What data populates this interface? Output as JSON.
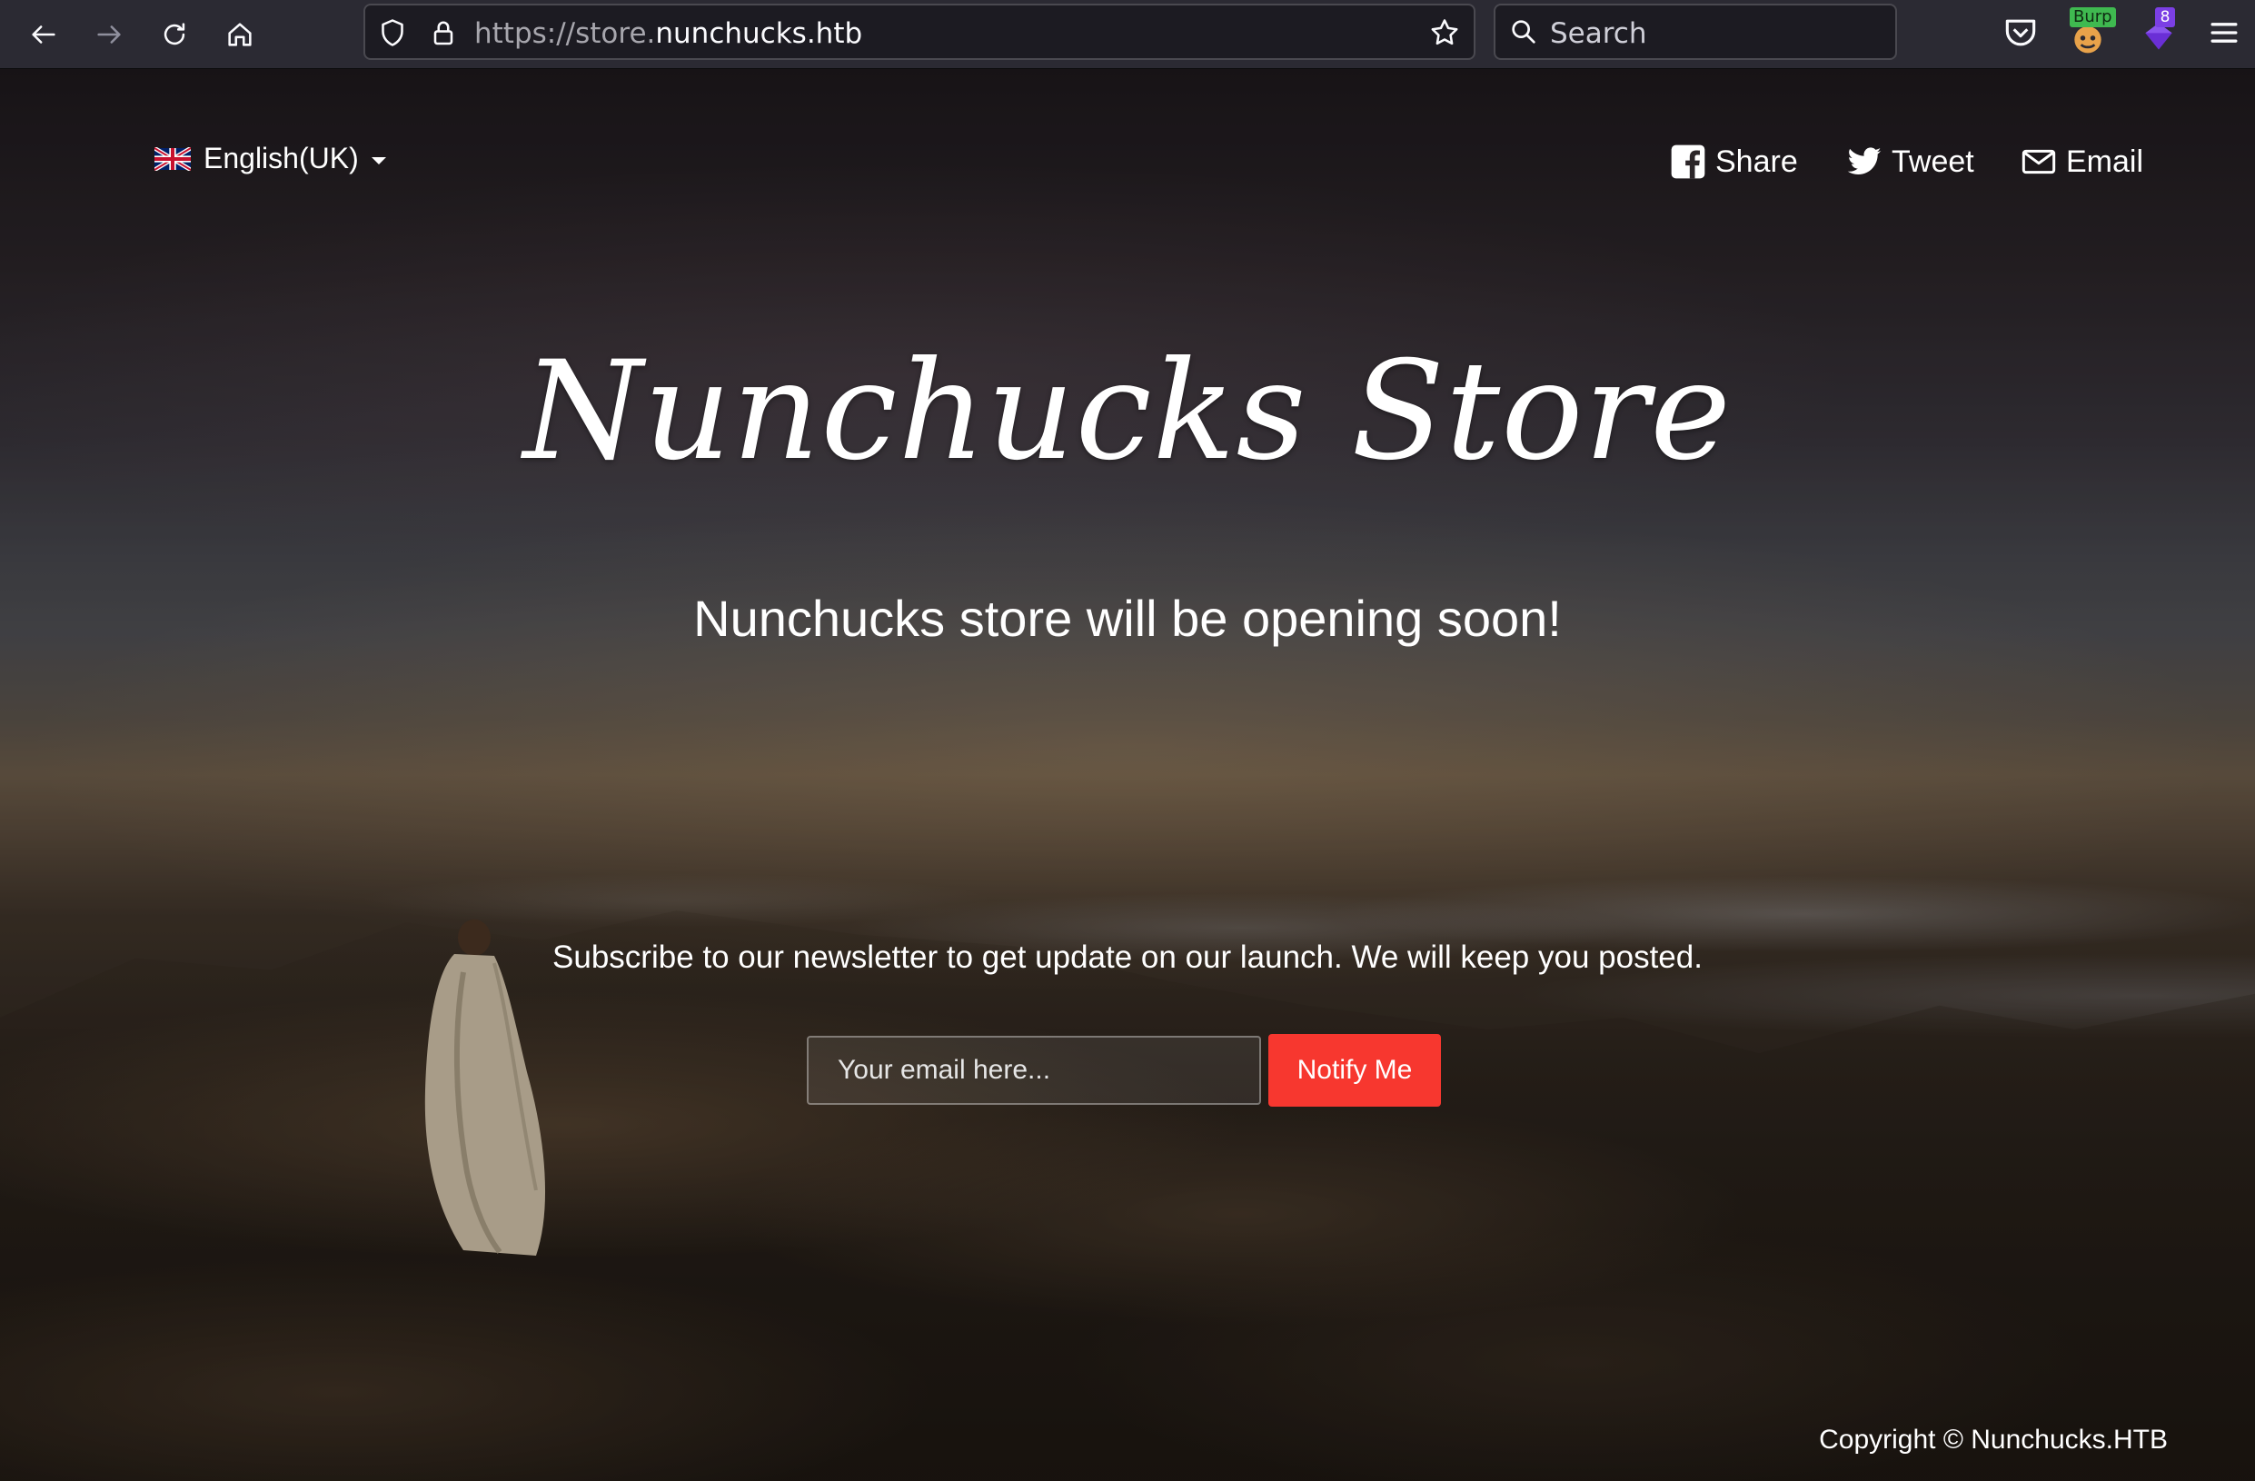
{
  "browser": {
    "url_scheme": "https://store.",
    "url_host": "nunchucks.htb",
    "search_placeholder": "Search",
    "burp_label": "Burp",
    "extension_count": "8"
  },
  "page": {
    "language": "English(UK)",
    "share_label": "Share",
    "tweet_label": "Tweet",
    "email_label": "Email",
    "title": "Nunchucks Store",
    "tagline": "Nunchucks store will be opening soon!",
    "subscribe_text": "Subscribe to our newsletter to get update on our launch. We will keep you posted.",
    "email_placeholder": "Your email here...",
    "notify_label": "Notify Me",
    "copyright": "Copyright © Nunchucks.HTB"
  },
  "colors": {
    "notify_button": "#f7372f",
    "chrome_bg": "#2b2a33"
  }
}
